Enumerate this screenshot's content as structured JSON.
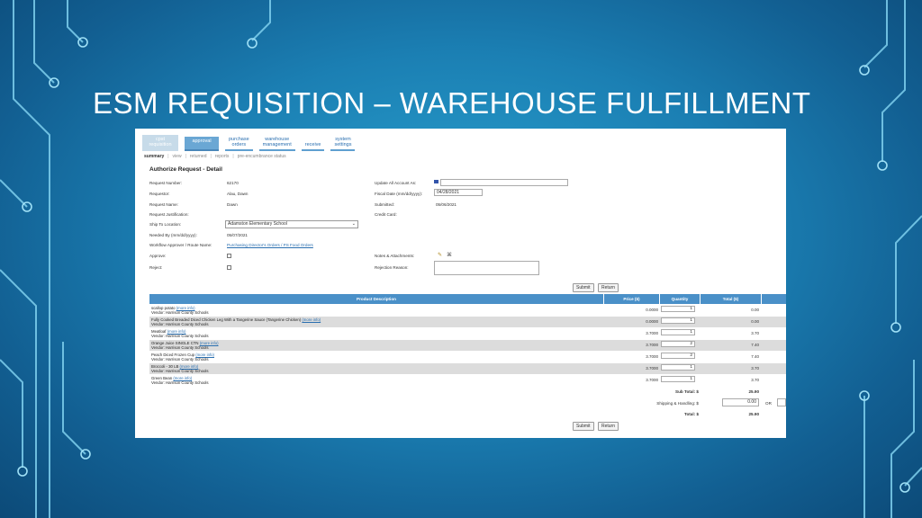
{
  "slide": {
    "title": "ESM REQUISITION – WAREHOUSE FULFILLMENT"
  },
  "colors": {
    "background": "#1b7fb3",
    "header": "#4a90c8",
    "tab_active": "#6aa7d4",
    "link": "#2a6fb0"
  },
  "nav": {
    "tabs": [
      {
        "label": "cpst\nrequisition"
      },
      {
        "label": "approval"
      },
      {
        "label": "purchase\norders"
      },
      {
        "label": "warehouse\nmanagement"
      },
      {
        "label": "receive"
      },
      {
        "label": "system\nsettings"
      }
    ],
    "subtabs": [
      "summary",
      "view",
      "returned",
      "reports",
      "pre-encumbrance status"
    ],
    "separator": "|"
  },
  "form": {
    "heading": "Authorize Request - Detail",
    "request_number_label": "Request Number:",
    "request_number": "62170",
    "requestor_label": "Requestor:",
    "requestor": "Alau, Dawn",
    "request_name_label": "Request Name:",
    "request_name": "Dawn",
    "justification_label": "Request Justification:",
    "ship_to_label": "Ship To Location:",
    "ship_to": "Adamston Elementary School",
    "needed_by_label": "Needed By (mm/dd/yyyy):",
    "needed_by": "05/07/2021",
    "workflow_label": "Workflow Approver / Route Name:",
    "workflow": "Purchasing Director's Orders / PS Food Orders",
    "approve_label": "Approve:",
    "reject_label": "Reject:",
    "update_account_label": "Update All Account As:",
    "fiscal_date_label": "Fiscal Date (mm/dd/yyyy):",
    "fiscal_date": "04/28/2021",
    "submitted_label": "Submitted:",
    "submitted": "05/06/2021",
    "credit_card_label": "Credit Card:",
    "notes_label": "Notes & Attachments:",
    "rejection_label": "Rejection Reason:",
    "submit": "Submit",
    "return": "Return"
  },
  "table": {
    "headers": [
      "Product Description",
      "Price ($)",
      "Quantity",
      "Total ($)"
    ],
    "more_info": "(more info)",
    "rows": [
      {
        "name": "scallop potato",
        "vendor": "Vendor: Harrison County Schools",
        "price": "0.0000",
        "qty": "1",
        "total": "0.00"
      },
      {
        "name": "Fully Cooked Breaded Diced Chicken Leg With a Tangerine Sauce (Tangerine Chicken)",
        "vendor": "Vendor: Harrison County Schools",
        "price": "0.0000",
        "qty": "1",
        "total": "0.00"
      },
      {
        "name": "Meatloaf",
        "vendor": "Vendor: Harrison County Schools",
        "price": "3.7000",
        "qty": "1",
        "total": "3.70"
      },
      {
        "name": "Orange Juice SINGLE CTN",
        "vendor": "Vendor: Harrison County Schools",
        "price": "3.7000",
        "qty": "2",
        "total": "7.40"
      },
      {
        "name": "Peach Diced Frozen Cup",
        "vendor": "Vendor: Harrison County Schools",
        "price": "3.7000",
        "qty": "2",
        "total": "7.40"
      },
      {
        "name": "Broccoli - 30 LB",
        "vendor": "Vendor: Harrison County Schools",
        "price": "3.7000",
        "qty": "1",
        "total": "3.70"
      },
      {
        "name": "Green Bean",
        "vendor": "Vendor: Harrison County Schools",
        "price": "3.7000",
        "qty": "1",
        "total": "3.70"
      }
    ],
    "subtotal_label": "Sub Total:  $",
    "subtotal": "25.90",
    "shipping_label": "Shipping & Handling:  $",
    "shipping": "0.00",
    "or_label": "OR",
    "total_label": "Total:  $",
    "total": "25.90"
  }
}
